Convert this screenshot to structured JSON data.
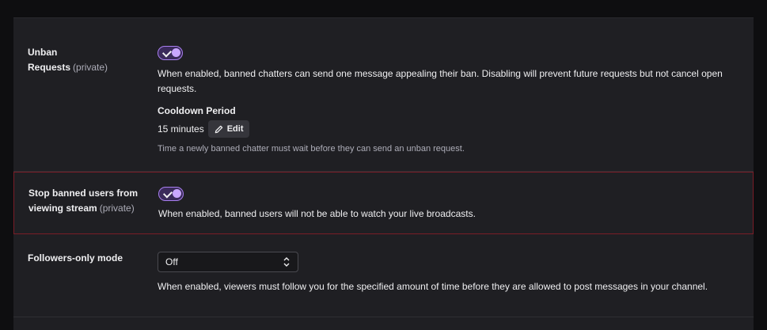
{
  "settings": {
    "unban": {
      "label_line1": "Unban",
      "label_line2": "Requests",
      "private_tag": "(private)",
      "toggle_on": true,
      "description": "When enabled, banned chatters can send one message appealing their ban. Disabling will prevent future requests but not cancel open requests.",
      "cooldown_title": "Cooldown Period",
      "cooldown_value": "15 minutes",
      "edit_label": "Edit",
      "cooldown_help": "Time a newly banned chatter must wait before they can send an unban request."
    },
    "stop_banned": {
      "label_line1": "Stop banned users from",
      "label_line2": "viewing stream",
      "private_tag": "(private)",
      "toggle_on": true,
      "description": "When enabled, banned users will not be able to watch your live broadcasts."
    },
    "followers_only": {
      "label": "Followers-only mode",
      "selected_option": "Off",
      "description": "When enabled, viewers must follow you for the specified amount of time before they are allowed to post messages in your channel."
    }
  },
  "colors": {
    "accent": "#a97ff0",
    "error_border": "#7a1d27",
    "panel_bg": "#1f1f23",
    "page_bg": "#0e0e10"
  },
  "icons": {
    "toggle_check": "check-icon",
    "edit": "pencil-icon",
    "select": "chevron-up-down-icon"
  }
}
